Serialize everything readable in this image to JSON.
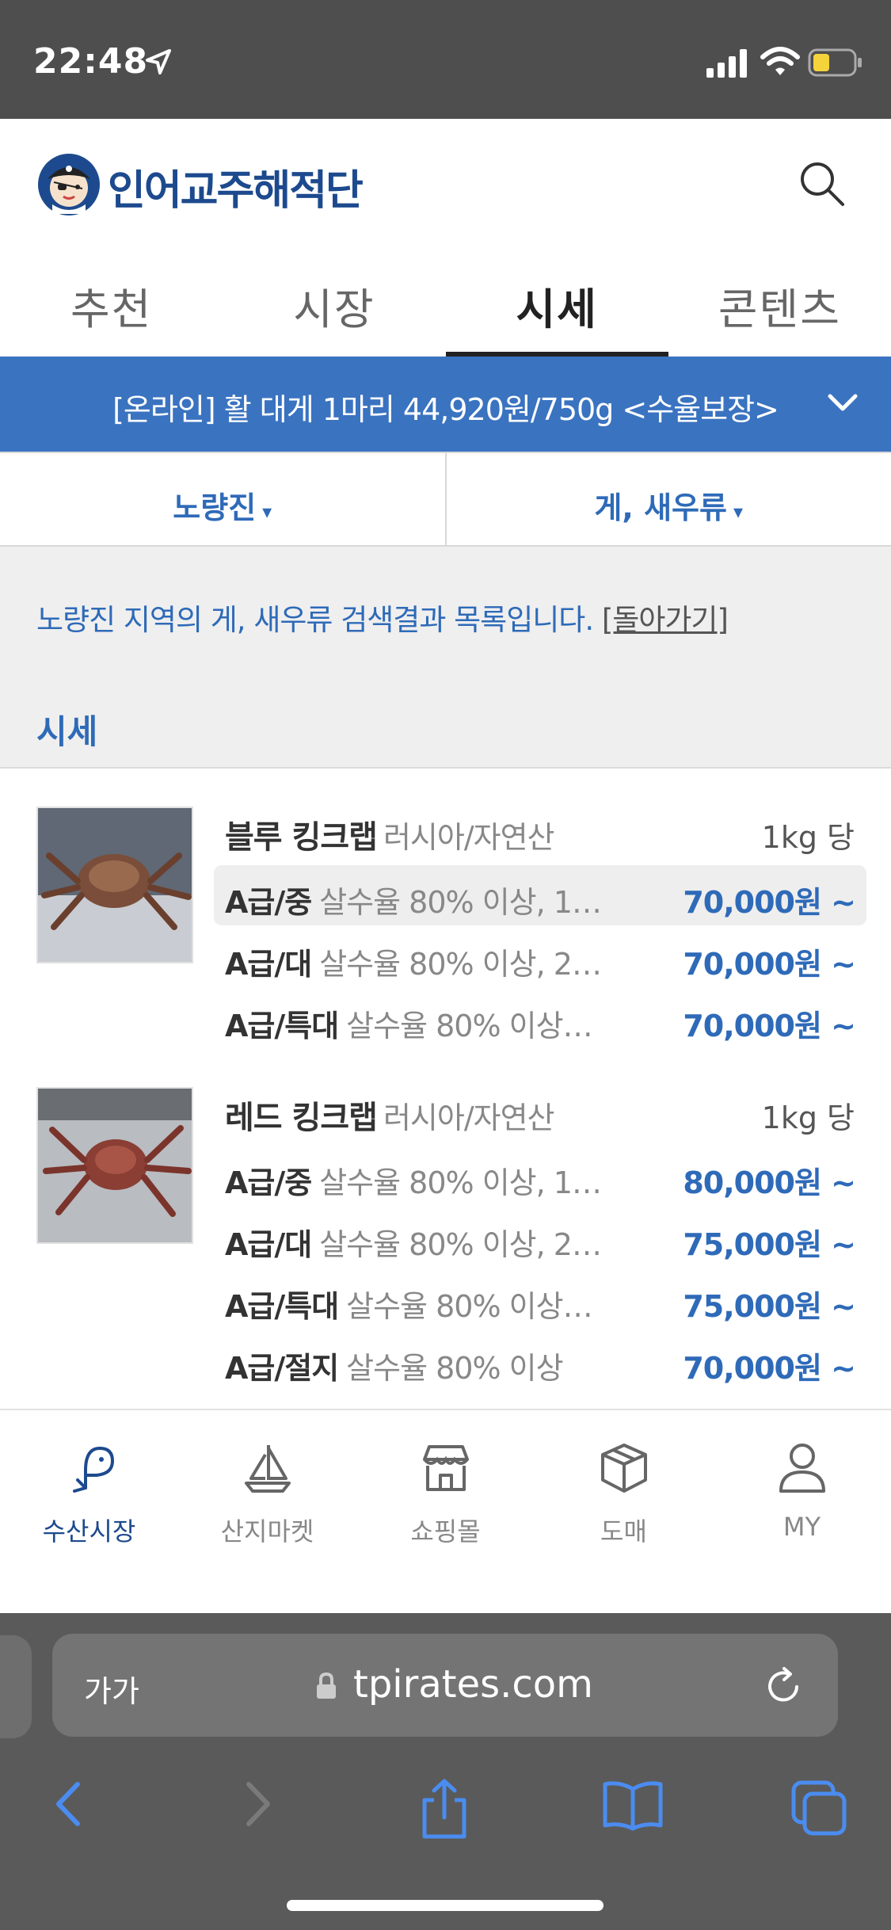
{
  "status_bar": {
    "time": "22:48"
  },
  "header": {
    "brand": "인어교주해적단"
  },
  "tabs": [
    {
      "label": "추천",
      "active": false
    },
    {
      "label": "시장",
      "active": false
    },
    {
      "label": "시세",
      "active": true
    },
    {
      "label": "콘텐츠",
      "active": false
    }
  ],
  "banner": {
    "text": "[온라인] 활 대게 1마리 44,920원/750g <수율보장>"
  },
  "filters": {
    "region": "노량진",
    "category": "게, 새우류",
    "arrow": "▾"
  },
  "info": {
    "message": "노량진 지역의 게, 새우류 검색결과 목록입니다.",
    "back_label": "[돌아가기]",
    "section_title": "시세"
  },
  "products": [
    {
      "name": "블루 킹크랩",
      "origin": "러시아/자연산",
      "unit": "1kg 당",
      "grades": [
        {
          "grade": "A급/중",
          "desc": "살수율 80% 이상, 1…",
          "price": "70,000원 ~"
        },
        {
          "grade": "A급/대",
          "desc": "살수율 80% 이상, 2…",
          "price": "70,000원 ~"
        },
        {
          "grade": "A급/특대",
          "desc": "살수율 80% 이상…",
          "price": "70,000원 ~"
        }
      ]
    },
    {
      "name": "레드 킹크랩",
      "origin": "러시아/자연산",
      "unit": "1kg 당",
      "grades": [
        {
          "grade": "A급/중",
          "desc": "살수율 80% 이상, 1…",
          "price": "80,000원 ~"
        },
        {
          "grade": "A급/대",
          "desc": "살수율 80% 이상, 2…",
          "price": "75,000원 ~"
        },
        {
          "grade": "A급/특대",
          "desc": "살수율 80% 이상…",
          "price": "75,000원 ~"
        },
        {
          "grade": "A급/절지",
          "desc": "살수율 80% 이상",
          "price": "70,000원 ~"
        }
      ]
    }
  ],
  "bottom_nav": [
    {
      "label": "수산시장",
      "icon": "fish-hook-icon",
      "active": true
    },
    {
      "label": "산지마켓",
      "icon": "sailboat-icon",
      "active": false
    },
    {
      "label": "쇼핑몰",
      "icon": "store-icon",
      "active": false
    },
    {
      "label": "도매",
      "icon": "box-icon",
      "active": false
    },
    {
      "label": "MY",
      "icon": "person-icon",
      "active": false
    }
  ],
  "browser": {
    "text_size": "가가",
    "url": "tpirates.com"
  },
  "colors": {
    "accent": "#2e6ab8",
    "brand": "#1d4a8e",
    "banner": "#3a73c0"
  }
}
